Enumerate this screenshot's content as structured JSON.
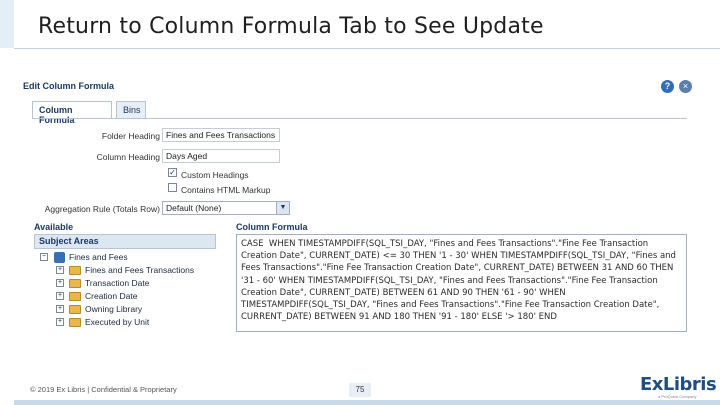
{
  "slide": {
    "title": "Return to Column Formula Tab to See Update",
    "footer": "© 2019 Ex Libris | Confidential & Proprietary",
    "page_number": "75",
    "logo_text": "ExLibris",
    "logo_sub": "a ProQuest Company"
  },
  "dialog": {
    "title": "Edit Column Formula",
    "help_icon": "?",
    "close_icon": "×",
    "tabs": [
      {
        "label": "Column Formula",
        "active": true
      },
      {
        "label": "Bins",
        "active": false
      }
    ],
    "folder_heading_label": "Folder Heading",
    "folder_heading_value": "Fines and Fees Transactions",
    "column_heading_label": "Column Heading",
    "column_heading_value": "Days Aged",
    "custom_headings_label": "Custom Headings",
    "custom_headings_checked": true,
    "html_markup_label": "Contains HTML Markup",
    "html_markup_checked": false,
    "aggregation_label": "Aggregation Rule (Totals Row)",
    "aggregation_value": "Default (None)",
    "available_heading": "Available",
    "subject_areas_heading": "Subject Areas",
    "tree": [
      {
        "label": "Fines and Fees",
        "icon": "database-icon",
        "expander": "−",
        "level": 0
      },
      {
        "label": "Fines and Fees Transactions",
        "icon": "folder-icon",
        "expander": "+",
        "level": 1
      },
      {
        "label": "Transaction Date",
        "icon": "folder-icon",
        "expander": "+",
        "level": 1
      },
      {
        "label": "Creation Date",
        "icon": "folder-icon",
        "expander": "+",
        "level": 1
      },
      {
        "label": "Owning Library",
        "icon": "folder-icon",
        "expander": "+",
        "level": 1
      },
      {
        "label": "Executed by Unit",
        "icon": "folder-icon",
        "expander": "+",
        "level": 1
      }
    ],
    "formula_heading": "Column Formula",
    "formula_text": "CASE  WHEN TIMESTAMPDIFF(SQL_TSI_DAY, \"Fines and Fees Transactions\".\"Fine Fee Transaction Creation Date\", CURRENT_DATE) <= 30 THEN '1 - 30' WHEN TIMESTAMPDIFF(SQL_TSI_DAY, \"Fines and Fees Transactions\".\"Fine Fee Transaction Creation Date\", CURRENT_DATE) BETWEEN 31 AND 60 THEN '31 - 60' WHEN TIMESTAMPDIFF(SQL_TSI_DAY, \"Fines and Fees Transactions\".\"Fine Fee Transaction Creation Date\", CURRENT_DATE) BETWEEN 61 AND 90 THEN '61 - 90' WHEN TIMESTAMPDIFF(SQL_TSI_DAY, \"Fines and Fees Transactions\".\"Fine Fee Transaction Creation Date\", CURRENT_DATE) BETWEEN 91 AND 180 THEN '91 - 180' ELSE '> 180' END"
  }
}
